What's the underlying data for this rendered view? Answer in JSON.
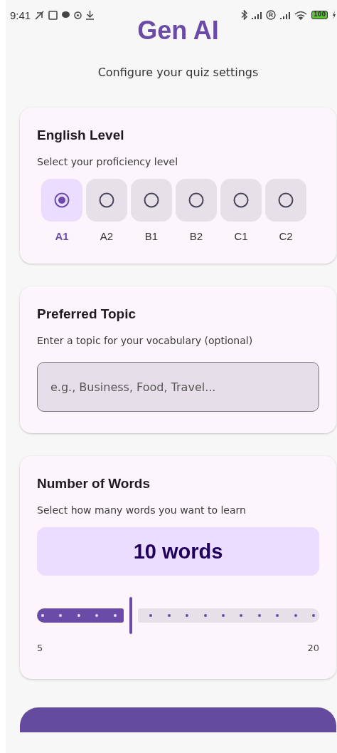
{
  "status_bar": {
    "time": "9:41",
    "battery": "100"
  },
  "title": "Gen AI",
  "subtitle": "Configure your quiz settings",
  "level_card": {
    "title": "English Level",
    "description": "Select your proficiency level",
    "options": [
      {
        "label": "A1",
        "selected": true
      },
      {
        "label": "A2",
        "selected": false
      },
      {
        "label": "B1",
        "selected": false
      },
      {
        "label": "B2",
        "selected": false
      },
      {
        "label": "C1",
        "selected": false
      },
      {
        "label": "C2",
        "selected": false
      }
    ]
  },
  "topic_card": {
    "title": "Preferred Topic",
    "description": "Enter a topic for your vocabulary (optional)",
    "placeholder": "e.g., Business, Food, Travel..."
  },
  "words_card": {
    "title": "Number of Words",
    "description": "Select how many words you want to learn",
    "value": "10 words",
    "slider": {
      "level": 0.3333,
      "min_label": "5",
      "max_label": "20"
    }
  }
}
